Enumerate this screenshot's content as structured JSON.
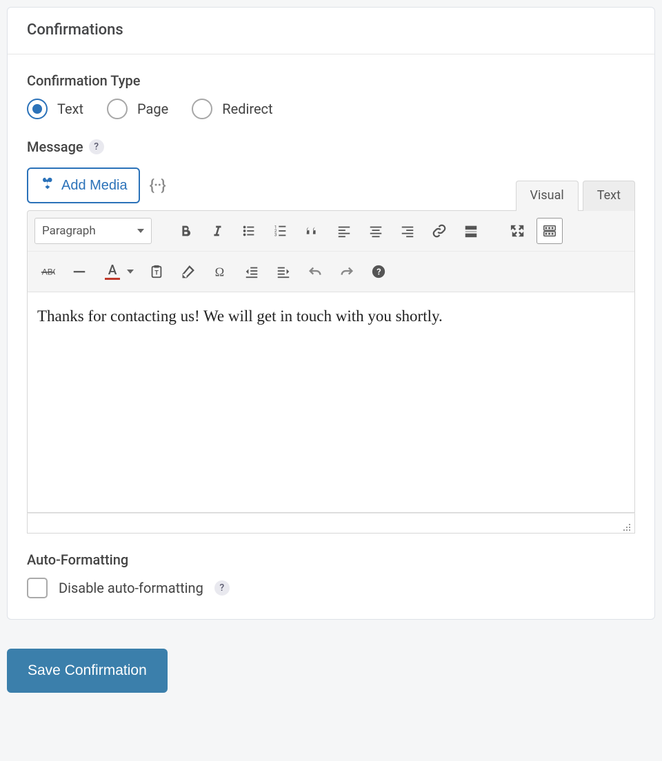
{
  "header": {
    "title": "Confirmations"
  },
  "type_section": {
    "label": "Confirmation Type",
    "options": [
      {
        "value": "text",
        "label": "Text",
        "selected": true
      },
      {
        "value": "page",
        "label": "Page",
        "selected": false
      },
      {
        "value": "redirect",
        "label": "Redirect",
        "selected": false
      }
    ]
  },
  "message_section": {
    "label": "Message",
    "help": "?",
    "add_media_label": "Add Media",
    "tabs": {
      "visual": "Visual",
      "text": "Text",
      "active": "visual"
    },
    "format_dropdown": "Paragraph",
    "content": "Thanks for contacting us! We will get in touch with you shortly."
  },
  "autofmt_section": {
    "label": "Auto-Formatting",
    "checkbox_label": "Disable auto-formatting",
    "checked": false,
    "help": "?"
  },
  "actions": {
    "save_label": "Save Confirmation"
  }
}
